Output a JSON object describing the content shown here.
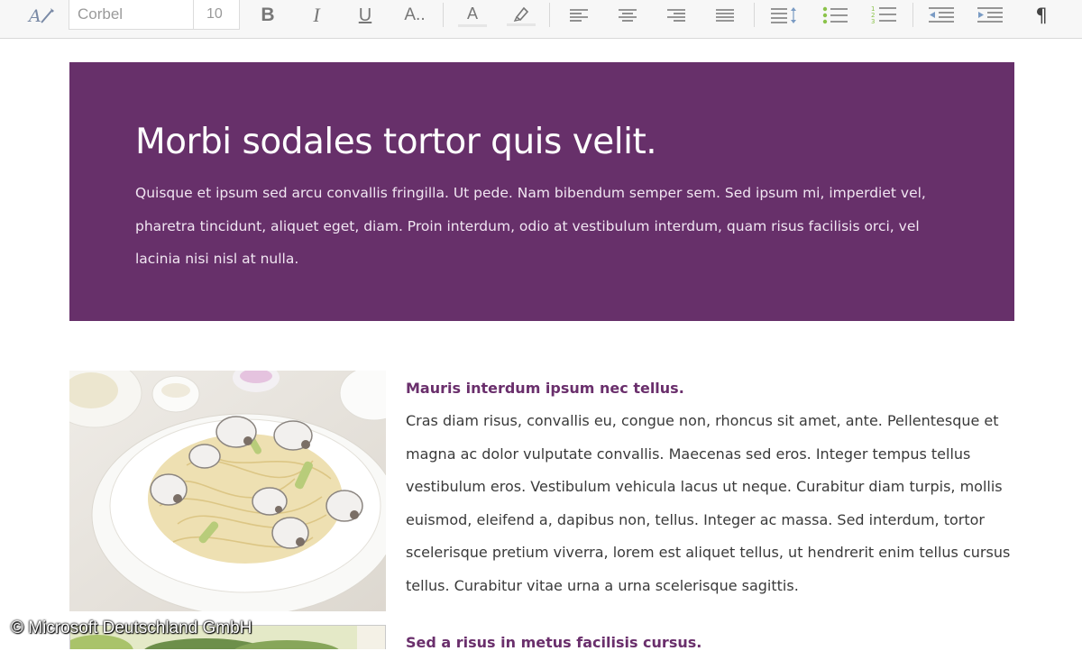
{
  "toolbar": {
    "font_name": "Corbel",
    "font_size": "10",
    "paragraph_mark": "¶",
    "bold_glyph": "B",
    "italic_glyph": "I",
    "underline_glyph": "U",
    "text_effects_glyph": "A..",
    "font_color_glyph": "A",
    "icons": [
      "format-painter-icon",
      "bold-icon",
      "italic-icon",
      "underline-icon",
      "text-effects-icon",
      "font-color-icon",
      "highlight-icon",
      "align-left-icon",
      "align-center-icon",
      "align-right-icon",
      "justify-icon",
      "line-spacing-icon",
      "bullet-list-icon",
      "numbered-list-icon",
      "decrease-indent-icon",
      "increase-indent-icon",
      "paragraph-mark-icon"
    ]
  },
  "document": {
    "banner": {
      "title": "Morbi sodales tortor quis velit.",
      "body": "Quisque et ipsum sed arcu convallis fringilla. Ut pede. Nam bibendum semper sem. Sed ipsum mi, imperdiet vel, pharetra tincidunt, aliquet eget, diam. Proin interdum, odio at vestibulum interdum, quam risus facilisis orci, vel lacinia nisi nisl at nulla."
    },
    "section1": {
      "heading": "Mauris interdum ipsum nec tellus.",
      "body": "Cras diam risus, convallis eu, congue non, rhoncus sit amet, ante. Pellentesque et magna ac dolor vulputate convallis. Maecenas sed eros. Integer tempus tellus vestibulum eros. Vestibulum vehicula lacus ut neque. Curabitur diam turpis, mollis euismod, eleifend a, dapibus non, tellus. Integer ac massa. Sed interdum, tortor scelerisque pretium viverra, lorem est aliquet tellus, ut hendrerit enim tellus cursus tellus. Curabitur vitae urna a urna scelerisque sagittis."
    },
    "section2": {
      "heading": "Sed a risus in metus facilisis cursus."
    }
  },
  "copyright": "© Microsoft Deutschland GmbH",
  "colors": {
    "banner": "#67306a",
    "heading": "#6a2f6c",
    "body_text": "#3a3a3a",
    "toolbar_bg": "#f7f7f7",
    "list_accent": "#8bc34a"
  }
}
